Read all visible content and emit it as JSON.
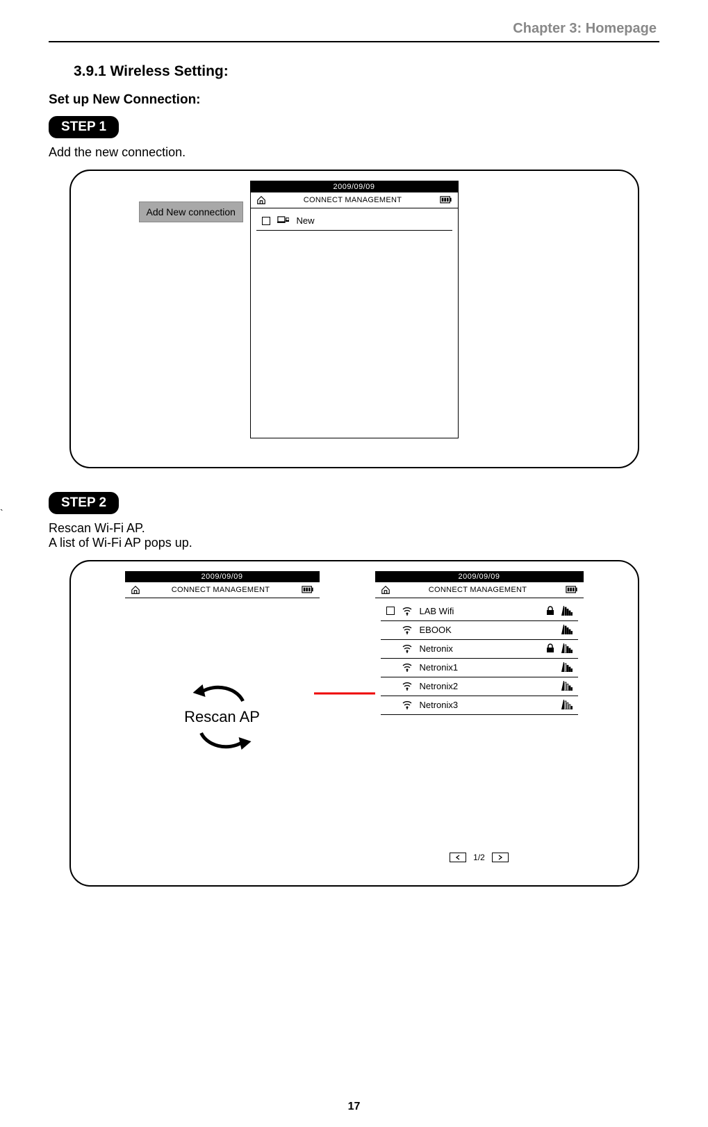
{
  "chapter_header": "Chapter 3: Homepage",
  "section_heading": "3.9.1 Wireless Setting:",
  "subheading": "Set up New Connection:",
  "step1": {
    "label": "STEP 1",
    "text": "Add the new connection."
  },
  "step2": {
    "label": "STEP 2",
    "text_line1": "Rescan Wi-Fi AP.",
    "text_line2": "A list of Wi-Fi AP pops up."
  },
  "device_common": {
    "date": "2009/09/09",
    "title": "CONNECT MANAGEMENT"
  },
  "shot1": {
    "tooltip": "Add New connection",
    "row": {
      "label": "New"
    }
  },
  "shot2_left": {
    "rescan_label": "Rescan AP"
  },
  "shot2_right": {
    "rows": [
      {
        "name": "LAB Wifi",
        "locked": true,
        "bars": 4,
        "sq": true
      },
      {
        "name": "EBOOK",
        "locked": false,
        "bars": 4,
        "sq": false
      },
      {
        "name": "Netronix",
        "locked": true,
        "bars": 3,
        "sq": false
      },
      {
        "name": "Netronix1",
        "locked": false,
        "bars": 3,
        "sq": false
      },
      {
        "name": "Netronix2",
        "locked": false,
        "bars": 2,
        "sq": false
      },
      {
        "name": "Netronix3",
        "locked": false,
        "bars": 1,
        "sq": false
      }
    ],
    "pager": "1/2"
  },
  "page_number": "17",
  "tick_mark": "`"
}
